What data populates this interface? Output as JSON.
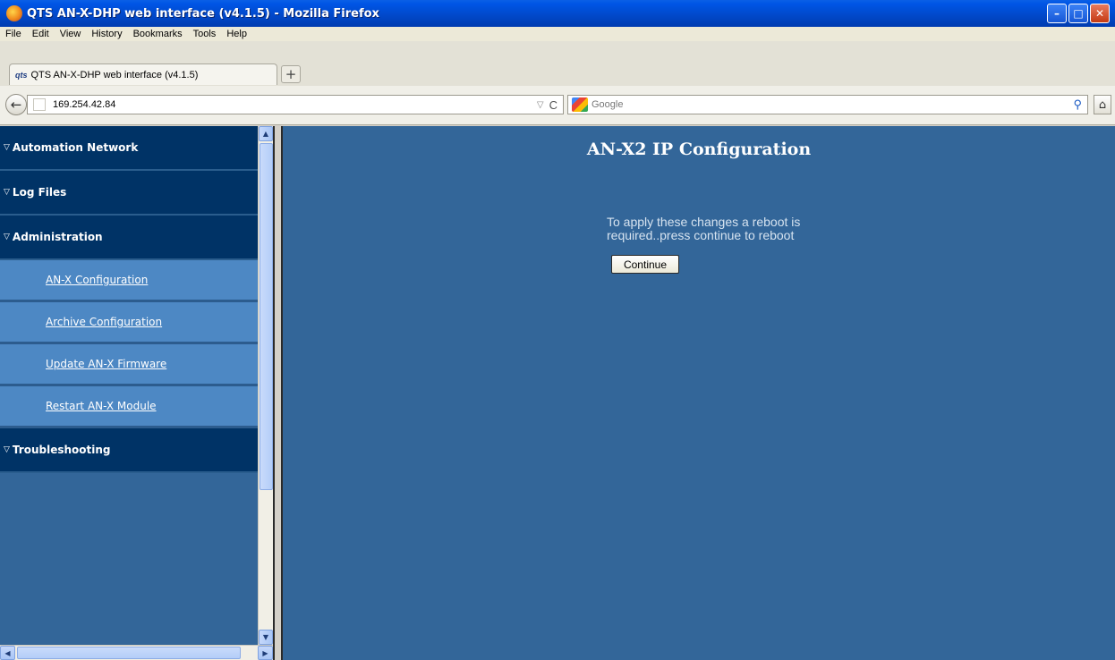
{
  "window": {
    "title": "QTS AN-X-DHP web interface (v4.1.5) - Mozilla Firefox",
    "buttons": {
      "minimize": "–",
      "maximize": "□",
      "close": "✕"
    }
  },
  "menu": [
    "File",
    "Edit",
    "View",
    "History",
    "Bookmarks",
    "Tools",
    "Help"
  ],
  "tab": {
    "favicon": "qts",
    "label": "QTS AN-X-DHP web interface (v4.1.5)",
    "new_tab": "+"
  },
  "nav": {
    "url": "169.254.42.84",
    "search_placeholder": "Google",
    "icons": {
      "back": "←",
      "dropdown": "▽",
      "reload": "C",
      "search": "⚲",
      "home": "⌂"
    }
  },
  "sidebar": {
    "sections": [
      {
        "label": "Automation Network"
      },
      {
        "label": "Log Files"
      },
      {
        "label": "Administration"
      }
    ],
    "admin_items": [
      {
        "label": "AN-X Configuration"
      },
      {
        "label": "Archive Configuration"
      },
      {
        "label": "Update AN-X Firmware"
      },
      {
        "label": "Restart AN-X Module"
      }
    ],
    "last_section": {
      "label": "Troubleshooting"
    }
  },
  "main": {
    "title": "AN-X2 IP Configuration",
    "notice": "To apply these changes a reboot is required..press continue to reboot",
    "continue_label": "Continue"
  },
  "colors": {
    "content_bg": "#336699",
    "section_bg": "#003366",
    "item_bg": "#4d88c4"
  }
}
